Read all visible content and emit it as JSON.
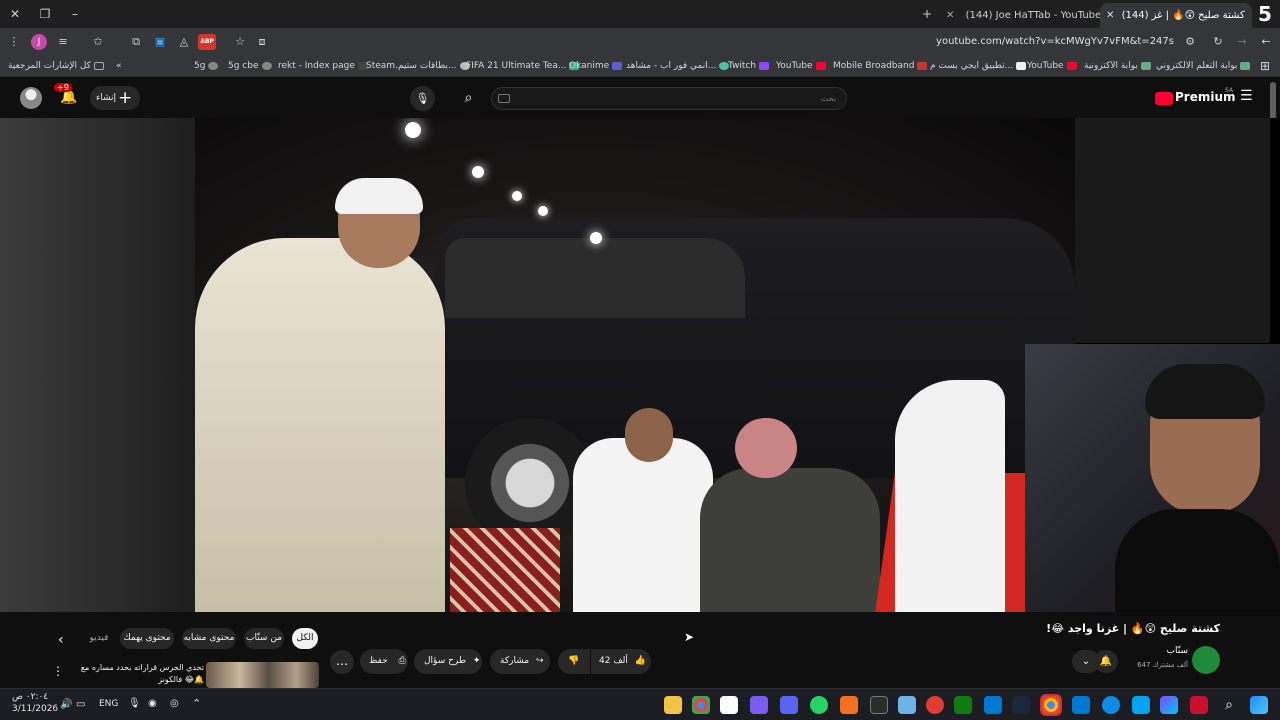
{
  "browser": {
    "tabs": [
      {
        "label": "(144) كشتة صليح 😲🔥 | غز",
        "active": true
      },
      {
        "label": "(144) Joe HaTTab - YouTube",
        "active": false
      }
    ],
    "url": "youtube.com/watch?v=kcMWgYv7vFM&t=247s",
    "ext_badge": "ABP",
    "corner_badge": "5"
  },
  "bookmarks": [
    {
      "label": "بوابة التعلم الالكتروني"
    },
    {
      "label": "بوابة الاكترونية"
    },
    {
      "label": "YouTube"
    },
    {
      "label": "تطبيق ايجي بست م..."
    },
    {
      "label": "Mobile Broadband"
    },
    {
      "label": "YouTube"
    },
    {
      "label": "Twitch"
    },
    {
      "label": "انمي فور اب - مشاهد..."
    },
    {
      "label": "Okanime"
    },
    {
      "label": "FIFA 21 Ultimate Tea..."
    },
    {
      "label": "بطاقات ستيم..."
    },
    {
      "label": "Steam..."
    },
    {
      "label": "rekt - Index page"
    },
    {
      "label": "5g cbe"
    },
    {
      "label": "5g"
    }
  ],
  "all_bookmarks": "كل الإشارات المرجعية",
  "youtube": {
    "logo": "Premium",
    "region": "SA",
    "search_placeholder": "بحث",
    "create_label": "إنشاء",
    "notif_badge": "+9"
  },
  "video": {
    "title": "كشتة صليح 😲🔥 | غزنا واجد 😂!",
    "channel": "سنّاب",
    "subscribers": "647 ألف مشترك",
    "likes": "42 ألف",
    "share": "مشاركة",
    "ask": "طرح سؤال",
    "save": "حفظ"
  },
  "chips": [
    "الكل",
    "من سنّاب",
    "محتوى مشابه",
    "محتوى يهمك",
    "فيديو"
  ],
  "recommendation": {
    "title": "تحدي الجرس قراراته بحدد مساره مع فالكونز",
    "emoji": "😂🔔"
  },
  "taskbar": {
    "lang": "ENG",
    "time": "٠٢:٠٤ ص",
    "date": "3/11/2026"
  }
}
